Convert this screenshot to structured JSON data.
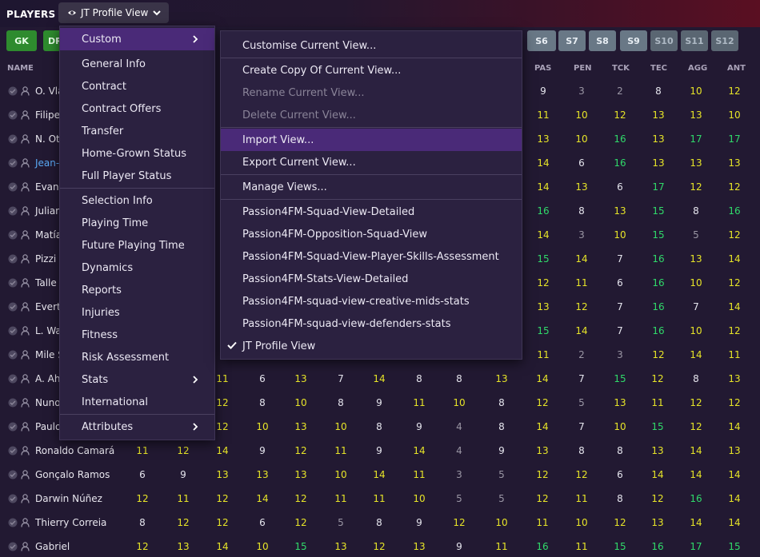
{
  "header": {
    "title": "PLAYERS",
    "view_label": "JT Profile View"
  },
  "positions": [
    "GK",
    "DR",
    "S6",
    "S7",
    "S8",
    "S9",
    "S10",
    "S11",
    "S12"
  ],
  "columns": {
    "name": "NAME",
    "stats": [
      "PAS",
      "PEN",
      "TCK",
      "TEC",
      "AGG",
      "ANT"
    ]
  },
  "colors": {
    "accent": "#4a2a78",
    "high_value": "#30d96a",
    "mid_value": "#e6e428",
    "low_value": "#9a96a4",
    "link": "#5aa9f5"
  },
  "players": [
    {
      "name": "O. Vla",
      "vals": [
        "9",
        "3",
        "2",
        "8",
        "10",
        "12"
      ]
    },
    {
      "name": "Filipe",
      "vals": [
        "11",
        "10",
        "12",
        "13",
        "13",
        "10"
      ]
    },
    {
      "name": "N. Ot",
      "vals": [
        "13",
        "10",
        "16",
        "13",
        "17",
        "17"
      ]
    },
    {
      "name": "Jean-",
      "vals": [
        "14",
        "6",
        "16",
        "13",
        "13",
        "13"
      ]
    },
    {
      "name": "Evanc",
      "vals": [
        "14",
        "13",
        "6",
        "17",
        "12",
        "12"
      ]
    },
    {
      "name": "Julian",
      "vals": [
        "16",
        "8",
        "13",
        "15",
        "8",
        "16"
      ]
    },
    {
      "name": "Matía",
      "vals": [
        "14",
        "3",
        "10",
        "15",
        "5",
        "12"
      ]
    },
    {
      "name": "Pizzi",
      "vals": [
        "15",
        "14",
        "7",
        "16",
        "13",
        "14"
      ]
    },
    {
      "name": "Talle",
      "vals": [
        "12",
        "11",
        "6",
        "16",
        "10",
        "12"
      ]
    },
    {
      "name": "Evert",
      "vals": [
        "13",
        "12",
        "7",
        "16",
        "7",
        "14"
      ]
    },
    {
      "name": "L. Wa",
      "vals": [
        "15",
        "14",
        "7",
        "16",
        "10",
        "12"
      ]
    },
    {
      "name": "Mile S",
      "vals": [
        "11",
        "2",
        "3",
        "12",
        "14",
        "11"
      ]
    },
    {
      "name": "A. Ah",
      "vals": [
        "11",
        "6",
        "13",
        "7",
        "14",
        "8",
        "8",
        "13",
        "14",
        "7",
        "15",
        "12",
        "8",
        "13"
      ]
    },
    {
      "name": "Nuno",
      "vals": [
        "12",
        "8",
        "10",
        "8",
        "9",
        "11",
        "10",
        "8",
        "12",
        "5",
        "13",
        "11",
        "12",
        "12"
      ]
    },
    {
      "name": "Paulo",
      "vals": [
        "12",
        "10",
        "13",
        "10",
        "8",
        "9",
        "4",
        "8",
        "14",
        "7",
        "10",
        "15",
        "12",
        "14"
      ]
    },
    {
      "name": "Ronaldo Camará",
      "vals": [
        "11",
        "12",
        "14",
        "9",
        "12",
        "11",
        "9",
        "14",
        "4",
        "9",
        "13",
        "8",
        "8",
        "13",
        "14",
        "13"
      ]
    },
    {
      "name": "Gonçalo Ramos",
      "vals": [
        "6",
        "9",
        "13",
        "13",
        "13",
        "10",
        "14",
        "11",
        "3",
        "5",
        "12",
        "12",
        "6",
        "14",
        "14",
        "14"
      ]
    },
    {
      "name": "Darwin Núñez",
      "vals": [
        "12",
        "11",
        "12",
        "14",
        "12",
        "11",
        "11",
        "10",
        "5",
        "5",
        "12",
        "11",
        "8",
        "12",
        "16",
        "14"
      ]
    },
    {
      "name": "Thierry Correia",
      "vals": [
        "8",
        "12",
        "12",
        "6",
        "12",
        "5",
        "8",
        "9",
        "12",
        "10",
        "11",
        "10",
        "12",
        "13",
        "14",
        "14"
      ]
    },
    {
      "name": "Gabriel",
      "vals": [
        "12",
        "13",
        "14",
        "10",
        "15",
        "13",
        "12",
        "13",
        "9",
        "11",
        "16",
        "11",
        "15",
        "16",
        "17",
        "15"
      ]
    }
  ],
  "menu_main": {
    "items": [
      "Custom",
      "General Info",
      "Contract",
      "Contract Offers",
      "Transfer",
      "Home-Grown Status",
      "Full Player Status",
      "Selection Info",
      "Playing Time",
      "Future Playing Time",
      "Dynamics",
      "Reports",
      "Injuries",
      "Fitness",
      "Risk Assessment",
      "Stats",
      "International",
      "Attributes"
    ]
  },
  "menu_sub": {
    "items": [
      "Customise Current View...",
      "Create Copy Of Current View...",
      "Rename Current View...",
      "Delete Current View...",
      "Import View...",
      "Export Current View...",
      "Manage Views...",
      "Passion4FM-Squad-View-Detailed",
      "Passion4FM-Opposition-Squad-View",
      "Passion4FM-Squad-View-Player-Skills-Assessment",
      "Passion4FM-Stats-View-Detailed",
      "Passion4FM-squad-view-creative-mids-stats",
      "Passion4FM-squad-view-defenders-stats",
      "JT Profile View"
    ]
  }
}
